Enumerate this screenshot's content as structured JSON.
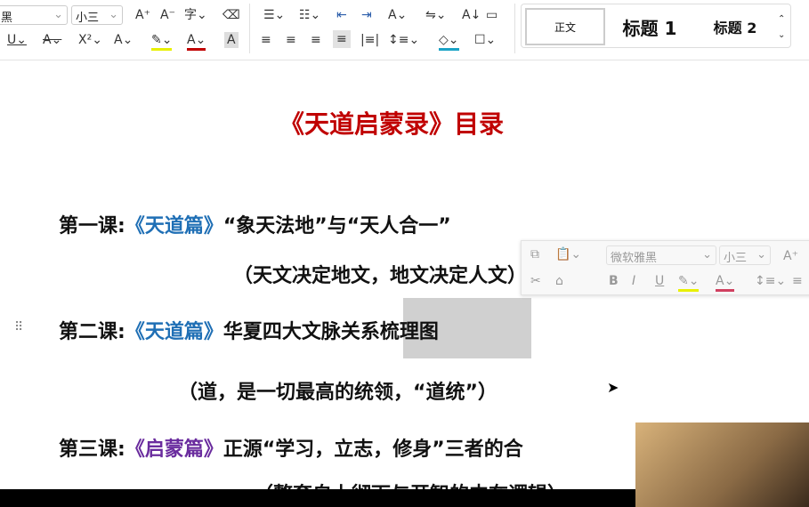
{
  "ribbon": {
    "font_name": "黑",
    "font_size": "小三",
    "font_size2": "小三",
    "styles": {
      "normal": "正文",
      "heading1": "标题 1",
      "heading2": "标题 2"
    }
  },
  "mini_toolbar": {
    "font_name": "微软雅黑",
    "font_size": "小三",
    "bold": "B",
    "italic": "I",
    "underline": "U"
  },
  "document": {
    "title": "《天道启蒙录》目录",
    "lessons": [
      {
        "label": "第一课:",
        "book": "《天道篇》",
        "text": "“象天法地”与“天人合一”",
        "sub": "（天文决定地文，地文决定人文）"
      },
      {
        "label": "第二课:",
        "book": "《天道篇》",
        "text": "华夏四大文脉关系梳理图",
        "sub": "（道，是一切最高的统领，“道统”）"
      },
      {
        "label": "第三课:",
        "book": "《启蒙篇》",
        "text": "正源“学习，立志，修身”三者的合",
        "sub": "（整套自上彻下与开智的内在逻辑）"
      }
    ]
  },
  "colors": {
    "title": "#c00000",
    "book_blue": "#1f6fb5",
    "book_purple": "#6a2c9e"
  }
}
